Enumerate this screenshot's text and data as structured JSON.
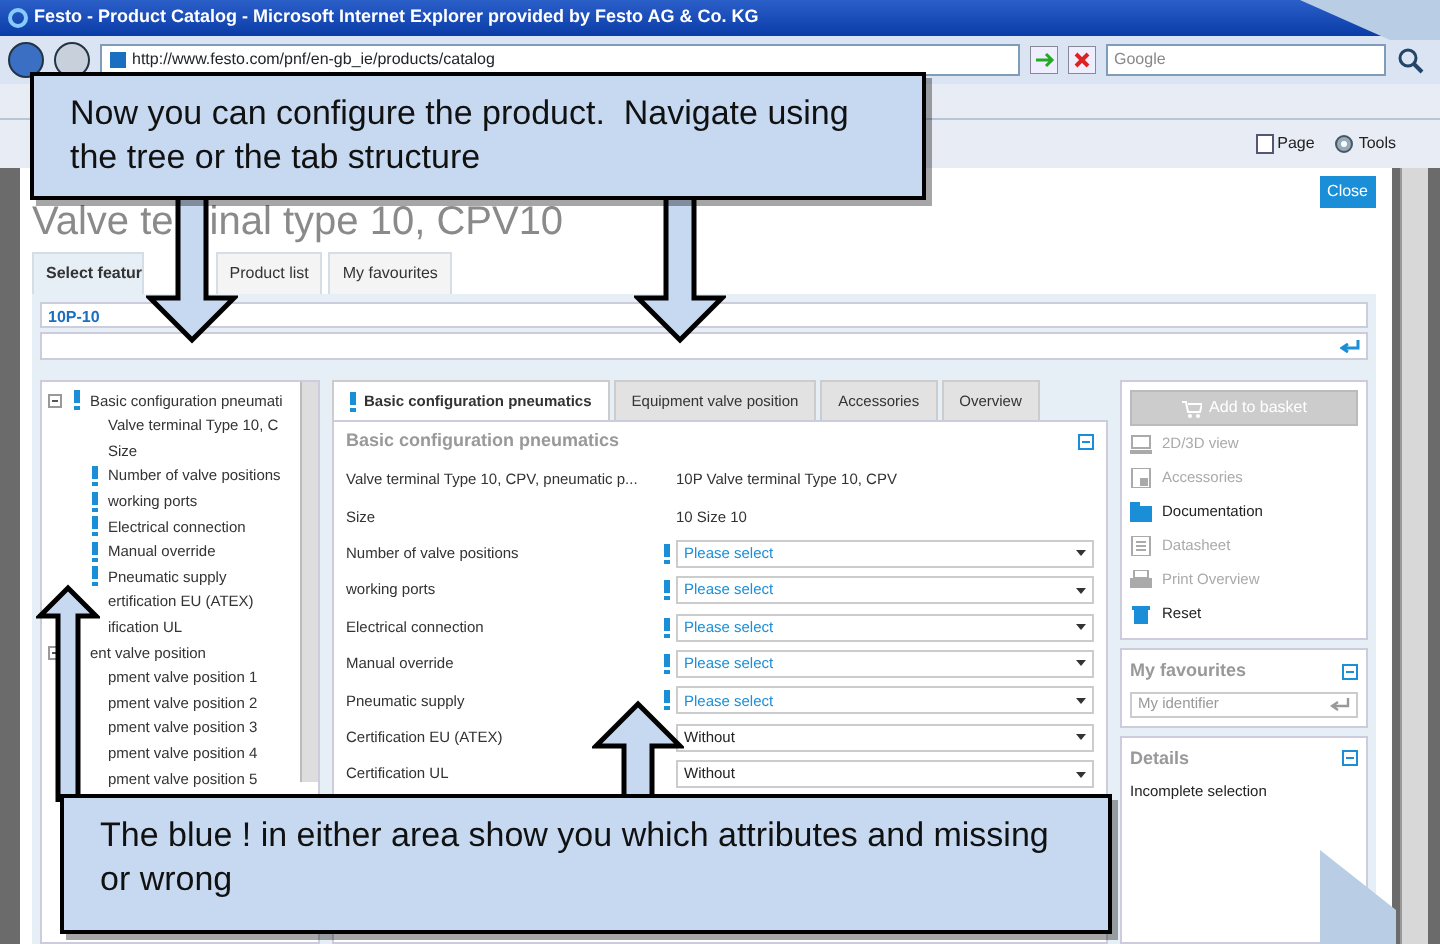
{
  "window": {
    "title": "Festo - Product Catalog - Microsoft Internet Explorer provided by Festo AG & Co. KG"
  },
  "address_bar": {
    "url": "http://www.festo.com/pnf/en-gb_ie/products/catalog"
  },
  "search": {
    "placeholder": "Google"
  },
  "command_bar": {
    "items": [
      "Page",
      "Tools"
    ]
  },
  "page": {
    "heading_parts": [
      "Valve te",
      "inal type 10, CPV10"
    ],
    "close": "Close"
  },
  "tabs": [
    {
      "label": "Select featur",
      "selected": true
    },
    {
      "label": "Product list",
      "selected": false
    },
    {
      "label": "My favourites",
      "selected": false
    }
  ],
  "product_code": "10P-10",
  "tree": [
    {
      "label": "Basic configuration pneumati",
      "missing": true,
      "expanded": true,
      "children": [
        {
          "label": "Valve terminal Type 10, C",
          "missing": false
        },
        {
          "label": "Size",
          "missing": false
        },
        {
          "label": "Number of valve positions",
          "missing": true
        },
        {
          "label": "working ports",
          "missing": true
        },
        {
          "label": "Electrical connection",
          "missing": true
        },
        {
          "label": "Manual override",
          "missing": true
        },
        {
          "label": "Pneumatic supply",
          "missing": true
        },
        {
          "label": "ertification EU (ATEX)",
          "missing": false
        },
        {
          "label": "ification UL",
          "missing": false
        }
      ]
    },
    {
      "label": "ent valve position",
      "missing": false,
      "expanded": true,
      "children": [
        {
          "label": "pment valve position 1",
          "missing": false
        },
        {
          "label": "pment valve position 2",
          "missing": false
        },
        {
          "label": "pment valve position 3",
          "missing": false
        },
        {
          "label": "pment valve position 4",
          "missing": false
        },
        {
          "label": "pment valve position 5",
          "missing": false
        }
      ]
    }
  ],
  "config_tabs": [
    {
      "label": "Basic configuration pneumatics",
      "selected": true,
      "missing": true
    },
    {
      "label": "Equipment valve position",
      "selected": false,
      "missing": false
    },
    {
      "label": "Accessories",
      "selected": false,
      "missing": false
    },
    {
      "label": "Overview",
      "selected": false,
      "missing": false
    }
  ],
  "section": {
    "title": "Basic configuration pneumatics",
    "rows": [
      {
        "label": "Valve terminal Type 10, CPV, pneumatic p...",
        "kind": "text",
        "value": "10P Valve terminal Type 10, CPV",
        "missing": false
      },
      {
        "label": "Size",
        "kind": "text",
        "value": "10 Size 10",
        "missing": false
      },
      {
        "label": "Number of valve positions",
        "kind": "select",
        "value": "Please select",
        "missing": true
      },
      {
        "label": "working ports",
        "kind": "select",
        "value": "Please select",
        "missing": true
      },
      {
        "label": "Electrical connection",
        "kind": "select",
        "value": "Please select",
        "missing": true
      },
      {
        "label": "Manual override",
        "kind": "select",
        "value": "Please select",
        "missing": true
      },
      {
        "label": "Pneumatic supply",
        "kind": "select",
        "value": "Please select",
        "missing": true
      },
      {
        "label": "Certification EU (ATEX)",
        "kind": "select",
        "value": "Without",
        "missing": false
      },
      {
        "label": "Certification UL",
        "kind": "select",
        "value": "Without",
        "missing": false
      }
    ]
  },
  "actions": {
    "basket": {
      "label": "Add to basket",
      "disabled": true
    },
    "items": [
      {
        "label": "2D/3D view",
        "disabled": true
      },
      {
        "label": "Accessories",
        "disabled": true
      },
      {
        "label": "Documentation",
        "disabled": false
      },
      {
        "label": "Datasheet",
        "disabled": true
      },
      {
        "label": "Print Overview",
        "disabled": true
      },
      {
        "label": "Reset",
        "disabled": false
      }
    ]
  },
  "favourites": {
    "title": "My favourites",
    "placeholder": "My identifier"
  },
  "details": {
    "title": "Details",
    "text": "Incomplete selection"
  },
  "callouts": [
    {
      "text": "Now you can configure the product.  Navigate using  the tree or the tab structure"
    },
    {
      "text": "The blue ! in either area show you which attributes and missing or wrong"
    }
  ]
}
